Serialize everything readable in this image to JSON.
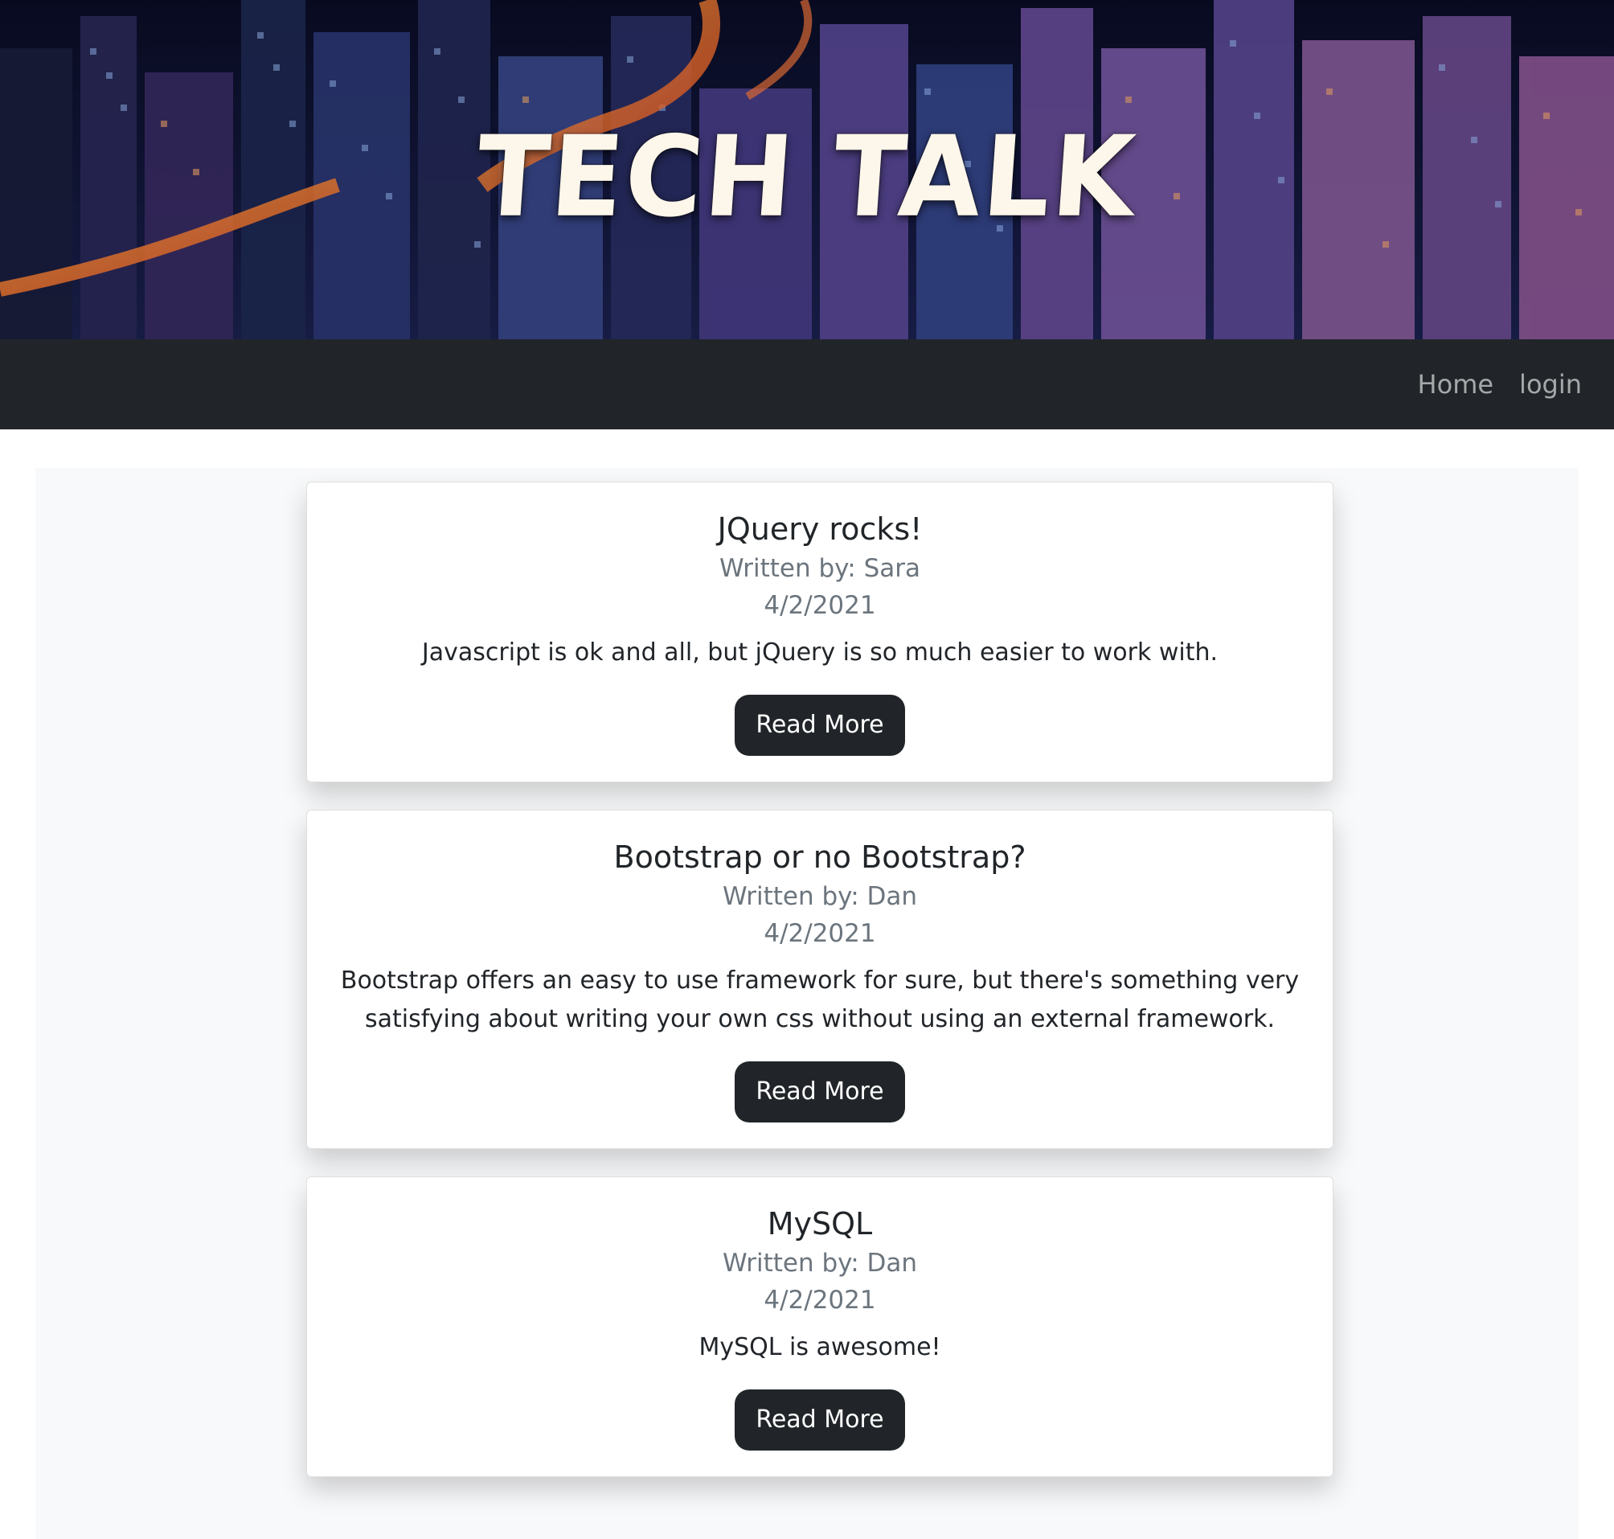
{
  "site": {
    "title": "TECH TALK"
  },
  "nav": {
    "items": [
      {
        "label": "Home"
      },
      {
        "label": "login"
      }
    ]
  },
  "posts": [
    {
      "title": "JQuery rocks!",
      "author": "Written by: Sara",
      "date": "4/2/2021",
      "body": "Javascript is ok and all, but jQuery is so much easier to work with.",
      "button": "Read More"
    },
    {
      "title": "Bootstrap or no Bootstrap?",
      "author": "Written by: Dan",
      "date": "4/2/2021",
      "body": "Bootstrap offers an easy to use framework for sure, but there's something very satisfying about writing your own css without using an external framework.",
      "button": "Read More"
    },
    {
      "title": "MySQL",
      "author": "Written by: Dan",
      "date": "4/2/2021",
      "body": "MySQL is awesome!",
      "button": "Read More"
    }
  ],
  "colors": {
    "navbar": "#212529",
    "button": "#212529",
    "muted_text": "#6c757d",
    "main_bg": "#f8f9fa"
  }
}
